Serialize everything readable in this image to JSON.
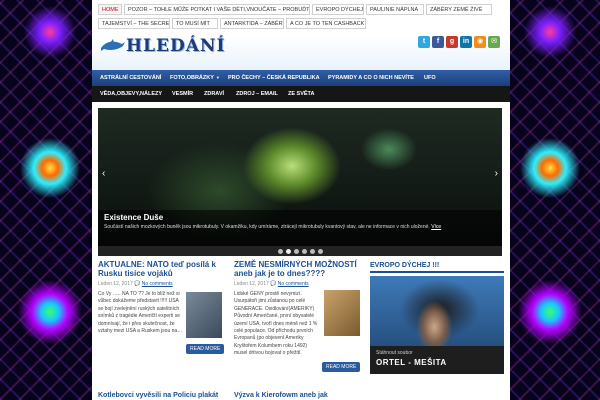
{
  "top_tabs": [
    "HOME",
    "POZOR – TOHLE MŮŽE POTKAT I VAŠE DĚTI,VNOUČATE – PROBUĎTE SE !!!",
    "EVROPO DÝCHEJ !",
    "PAULINIE NÁPLNA",
    "ZÁBĚRY ZEMĚ ŽIVÉ",
    "TAJEMSTVÍ – THE SECRET",
    "TO MUSÍ MÍT",
    "ANTARKTIDA – ZÁBĚRY",
    "A CO JE TO TEN CASHBACK ?"
  ],
  "logo": {
    "text": "HLEDÁNÍ"
  },
  "social": [
    {
      "icon": "twitter-icon",
      "glyph": "t",
      "color": "#2fa8e0"
    },
    {
      "icon": "facebook-icon",
      "glyph": "f",
      "color": "#3b5998"
    },
    {
      "icon": "googleplus-icon",
      "glyph": "g",
      "color": "#c43a2b"
    },
    {
      "icon": "linkedin-icon",
      "glyph": "in",
      "color": "#0e76a8"
    },
    {
      "icon": "rss-icon",
      "glyph": "◉",
      "color": "#f28c1e"
    },
    {
      "icon": "email-icon",
      "glyph": "✉",
      "color": "#6aa84f"
    }
  ],
  "nav_primary": [
    {
      "label": "ASTRÁLNÍ CESTOVÁNÍ",
      "dropdown": false
    },
    {
      "label": "FOTO,OBRÁZKY",
      "dropdown": true
    },
    {
      "label": "PRO ČECHY – ČESKÁ REPUBLIKA",
      "dropdown": false
    },
    {
      "label": "PYRAMIDY A CO O NICH NEVÍTE",
      "dropdown": false
    },
    {
      "label": "UFO",
      "dropdown": false
    }
  ],
  "nav_secondary": [
    {
      "label": "VĚDA,OBJEVY,NÁLEZY",
      "dropdown": false
    },
    {
      "label": "VESMÍR",
      "dropdown": false
    },
    {
      "label": "ZDRAVÍ",
      "dropdown": false
    },
    {
      "label": "ZDROJ – EMAIL",
      "dropdown": false
    },
    {
      "label": "ZE SVĚTA",
      "dropdown": false
    }
  ],
  "slider": {
    "title": "Existence Duše",
    "text": "Součástí našich mozkových buněk jsou mikrotubuly. V okamžiku, kdy umíráme, ztrácejí mikrotubuly kvantový stav, ale ne informace v nich uložené.",
    "more": "Více",
    "prev": "‹",
    "next": "›",
    "active_slide": 1,
    "slides_count": 6
  },
  "posts": [
    {
      "title": "AKTUALNE: NATO teď posílá k Rusku tisíce vojáků",
      "date": "Leden 12, 2017",
      "comments": "No comments",
      "body": "Co Vy ….. NA TO ?? Je to blíž než si vůbec dokážeme představit !!!!! USA se bojí zvelejnění ruských satelitních snímků z tragédie Američtí experti se domnívají, že i přes skutečnost, že vztahy mezi USA a Ruskem jsou na…",
      "read_more": "READ MORE"
    },
    {
      "title": "ZEMĚ NESMÍRNÝCH MOŽNOSTÍ aneb jak je to dnes????",
      "date": "Leden 12, 2017",
      "comments": "No comments",
      "body": "Lidské GENY prostě nevymizí. Usurpátoři jimi zůstanou po celé GENERACE. Osidlování(AMERIKY) Původní Američané, první obyvatelé území USA, tvoří dnes méně než 1 % celé populace. Od příchodu prvních Evropanů (po objevení Ameriky Kryštofem Kolumbem roku 1492) musel drtivou bojovat o přežití.",
      "read_more": "READ MORE"
    }
  ],
  "sidebar": {
    "title": "EVROPO DÝCHEJ !!!",
    "video_small": "Stáhnout soubor",
    "video_title": "ORTEL - MEŠITA"
  },
  "lower_titles": [
    "Kotlebovci vyvěsili na Policiu plakát",
    "Výzva k Kierofowm aneb jak"
  ]
}
